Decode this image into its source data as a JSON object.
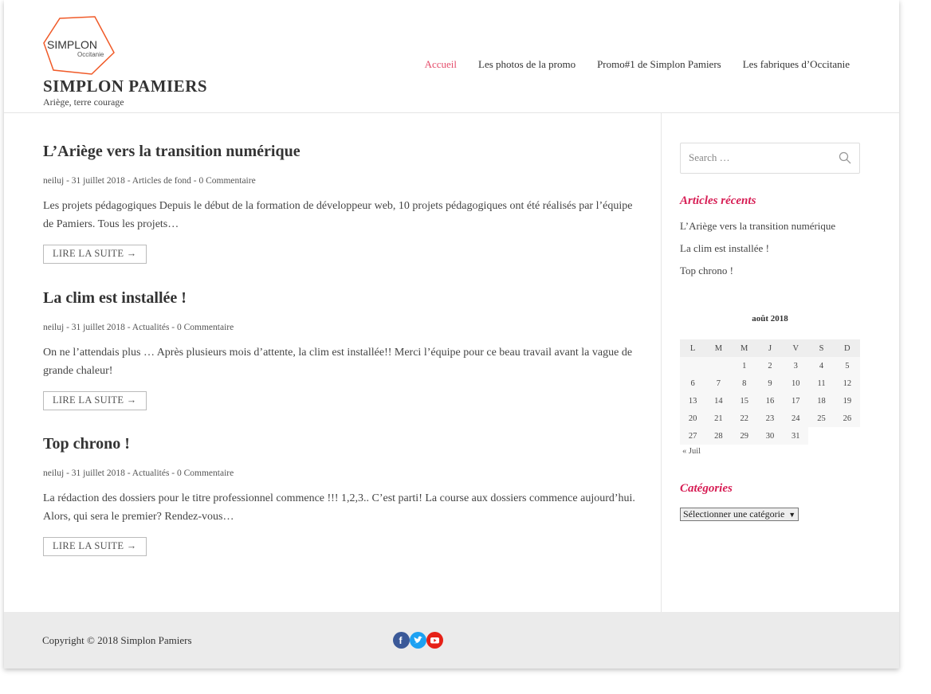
{
  "header": {
    "logo_text": "SIMPLON",
    "logo_subtext": "Occitanie",
    "site_title": "SIMPLON PAMIERS",
    "site_description": "Ariège, terre courage",
    "nav": [
      {
        "label": "Accueil"
      },
      {
        "label": "Les photos de la promo"
      },
      {
        "label": "Promo#1 de Simplon Pamiers"
      },
      {
        "label": "Les fabriques d’Occitanie"
      }
    ],
    "active_color": "#e54d6b"
  },
  "posts": [
    {
      "title": "L’Ariège vers la transition numérique",
      "meta": "neiluj - 31 juillet 2018 - Articles de fond - 0 Commentaire",
      "excerpt": "Les projets pédagogiques Depuis le début de la formation de développeur web, 10 projets pédagogiques ont été réalisés par l’équipe de Pamiers. Tous les projets…",
      "read_more": "LIRE LA SUITE →"
    },
    {
      "title": "La clim est installée !",
      "meta": "neiluj - 31 juillet 2018 - Actualités - 0 Commentaire",
      "excerpt": "On ne l’attendais plus … Après plusieurs mois d’attente, la clim est installée!! Merci l’équipe pour ce beau travail avant la vague de grande chaleur!",
      "read_more": "LIRE LA SUITE →"
    },
    {
      "title": "Top chrono !",
      "meta": "neiluj - 31 juillet 2018 - Actualités - 0 Commentaire",
      "excerpt": "La rédaction des dossiers pour le titre professionnel commence !!! 1,2,3.. C’est parti! La course aux dossiers commence aujourd’hui. Alors, qui sera le premier? Rendez-vous…",
      "read_more": "LIRE LA SUITE →"
    }
  ],
  "sidebar": {
    "search_placeholder": "Search …",
    "recent_title": "Articles récents",
    "recent": [
      "L’Ariège vers la transition numérique",
      "La clim est installée !",
      "Top chrono !"
    ],
    "calendar": {
      "caption": "août 2018",
      "days": [
        "L",
        "M",
        "M",
        "J",
        "V",
        "S",
        "D"
      ],
      "weeks": [
        [
          "",
          "",
          "1",
          "2",
          "3",
          "4",
          "5"
        ],
        [
          "6",
          "7",
          "8",
          "9",
          "10",
          "11",
          "12"
        ],
        [
          "13",
          "14",
          "15",
          "16",
          "17",
          "18",
          "19"
        ],
        [
          "20",
          "21",
          "22",
          "23",
          "24",
          "25",
          "26"
        ],
        [
          "27",
          "28",
          "29",
          "30",
          "31",
          "",
          ""
        ]
      ],
      "prev": "« Juil"
    },
    "categories_title": "Catégories",
    "categories_select": "Sélectionner une catégorie",
    "widget_title_color": "#d71d54"
  },
  "footer": {
    "copyright": "Copyright © 2018 Simplon Pamiers",
    "social": [
      {
        "name": "facebook-icon",
        "color": "#3b5998"
      },
      {
        "name": "twitter-icon",
        "color": "#1da1f2"
      },
      {
        "name": "youtube-icon",
        "color": "#e62117"
      }
    ]
  }
}
